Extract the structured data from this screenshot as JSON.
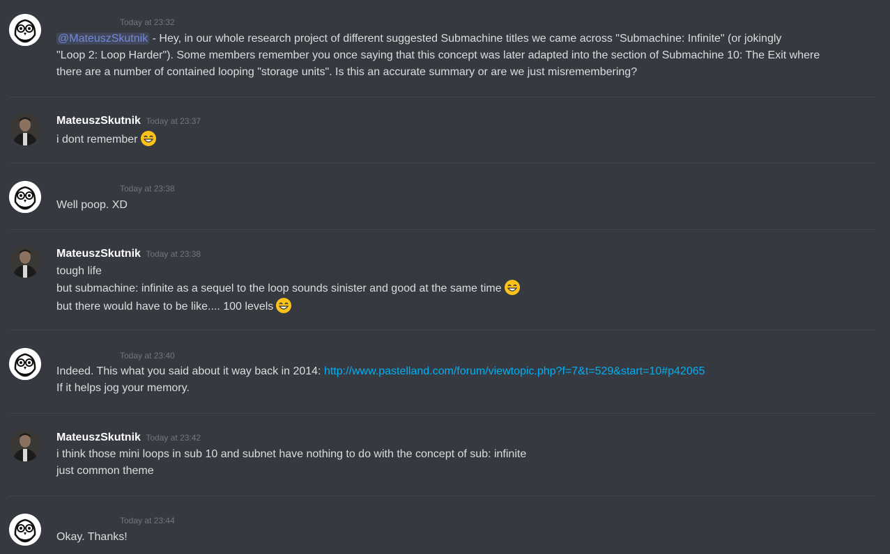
{
  "messages": [
    {
      "user": "",
      "avatar": "owl-avatar",
      "timestamp": "Today at 23:32",
      "mention": "@MateuszSkutnik",
      "lines": [
        " - Hey, in our whole research project of different suggested Submachine titles we came across \"Submachine: Infinite\" (or jokingly",
        "\"Loop 2: Loop Harder\"). Some members remember you once saying that this concept was later adapted into the section of Submachine 10: The Exit where",
        "there are a number of contained looping \"storage units\". Is this an accurate summary or are we just misremembering?"
      ]
    },
    {
      "user": "MateuszSkutnik",
      "avatar": "photo-avatar",
      "timestamp": "Today at 23:37",
      "lines": [
        "i dont remember"
      ],
      "emoji": "grinning-face-emoji"
    },
    {
      "user": "",
      "avatar": "owl-avatar",
      "timestamp": "Today at 23:38",
      "lines": [
        "Well poop. XD"
      ]
    },
    {
      "user": "MateuszSkutnik",
      "avatar": "photo-avatar",
      "timestamp": "Today at 23:38",
      "lines": [
        "tough life",
        "but submachine: infinite as a sequel to the loop sounds sinister and good at the same time",
        "but there would have to be like.... 100 levels"
      ],
      "emoji": "grinning-face-emoji"
    },
    {
      "user": "",
      "avatar": "owl-avatar",
      "timestamp": "Today at 23:40",
      "lines": [
        "Indeed. This what you said about it way back in 2014: ",
        "If it helps jog your memory."
      ],
      "link": "http://www.pastelland.com/forum/viewtopic.php?f=7&t=529&start=10#p42065"
    },
    {
      "user": "MateuszSkutnik",
      "avatar": "photo-avatar",
      "timestamp": "Today at 23:42",
      "lines": [
        "i think those mini loops in sub 10 and subnet have nothing to do with the concept of sub: infinite",
        "just common theme"
      ]
    },
    {
      "user": "",
      "avatar": "owl-avatar",
      "timestamp": "Today at 23:44",
      "lines": [
        "Okay. Thanks!"
      ]
    }
  ],
  "colors": {
    "background": "#36393f",
    "text": "#dcddde",
    "timestamp": "#72767d",
    "mention": "#7289da",
    "link": "#00b0f4",
    "separator": "#42454a"
  }
}
